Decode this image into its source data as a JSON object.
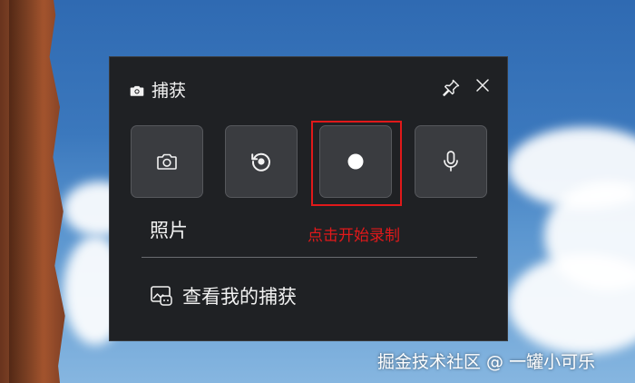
{
  "panel": {
    "title": "捕获",
    "labels": {
      "photo": "照片",
      "record_hint": "点击开始录制"
    },
    "view_captures": "查看我的捕获"
  },
  "watermark": "掘金技术社区 @ 一罐小可乐",
  "colors": {
    "panel_bg": "#1f2124",
    "button_bg": "#3a3c40",
    "highlight": "#e0191a",
    "text": "#f2f2f2"
  },
  "icons": {
    "header": "camera-icon",
    "pin": "pin-icon",
    "close": "close-icon",
    "photo_button": "camera-icon",
    "replay_button": "replay-icon",
    "record_button": "record-dot-icon",
    "mic_button": "microphone-icon",
    "gallery": "gallery-icon"
  }
}
